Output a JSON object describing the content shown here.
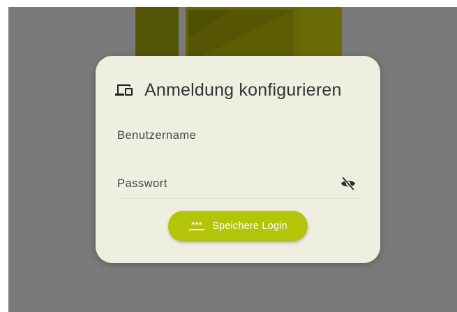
{
  "dialog": {
    "icon": "devices-icon",
    "title": "Anmeldung konfigurieren",
    "fields": {
      "username_label": "Benutzername",
      "password_label": "Passwort",
      "password_toggle_icon": "eye-off-icon"
    },
    "save_button": {
      "icon": "password-dots-icon",
      "label": "Speichere Login"
    }
  },
  "colors": {
    "scrim": "#7a7a7a",
    "dialog_surface": "#efefe1",
    "accent": "#b4c408",
    "text_primary": "#333333"
  }
}
